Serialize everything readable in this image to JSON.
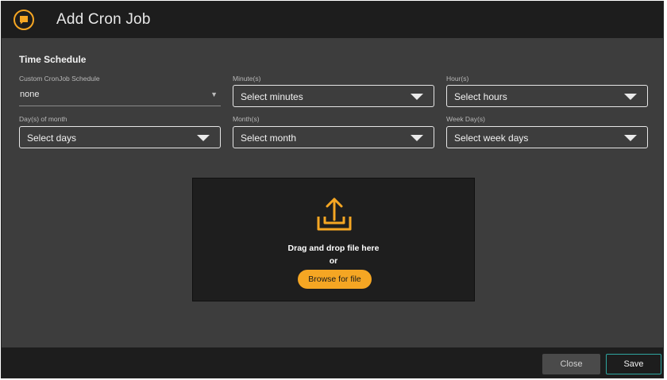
{
  "header": {
    "title": "Add Cron Job",
    "logo_icon": "chat-bubble-icon"
  },
  "section": {
    "title": "Time Schedule"
  },
  "fields": {
    "custom": {
      "label": "Custom CronJob Schedule",
      "value": "none"
    },
    "minutes": {
      "label": "Minute(s)",
      "value": "Select minutes"
    },
    "hours": {
      "label": "Hour(s)",
      "value": "Select hours"
    },
    "days": {
      "label": "Day(s) of month",
      "value": "Select days"
    },
    "months": {
      "label": "Month(s)",
      "value": "Select month"
    },
    "weekdays": {
      "label": "Week Day(s)",
      "value": "Select week days"
    }
  },
  "upload": {
    "icon": "upload-tray-icon",
    "drop_text": "Drag and drop file here",
    "or_text": "or",
    "browse_label": "Browse for file"
  },
  "footer": {
    "close_label": "Close",
    "save_label": "Save"
  },
  "colors": {
    "accent": "#f5a623",
    "save_border": "#2fa6a0",
    "background": "#3d3d3d",
    "header": "#1d1d1d"
  }
}
